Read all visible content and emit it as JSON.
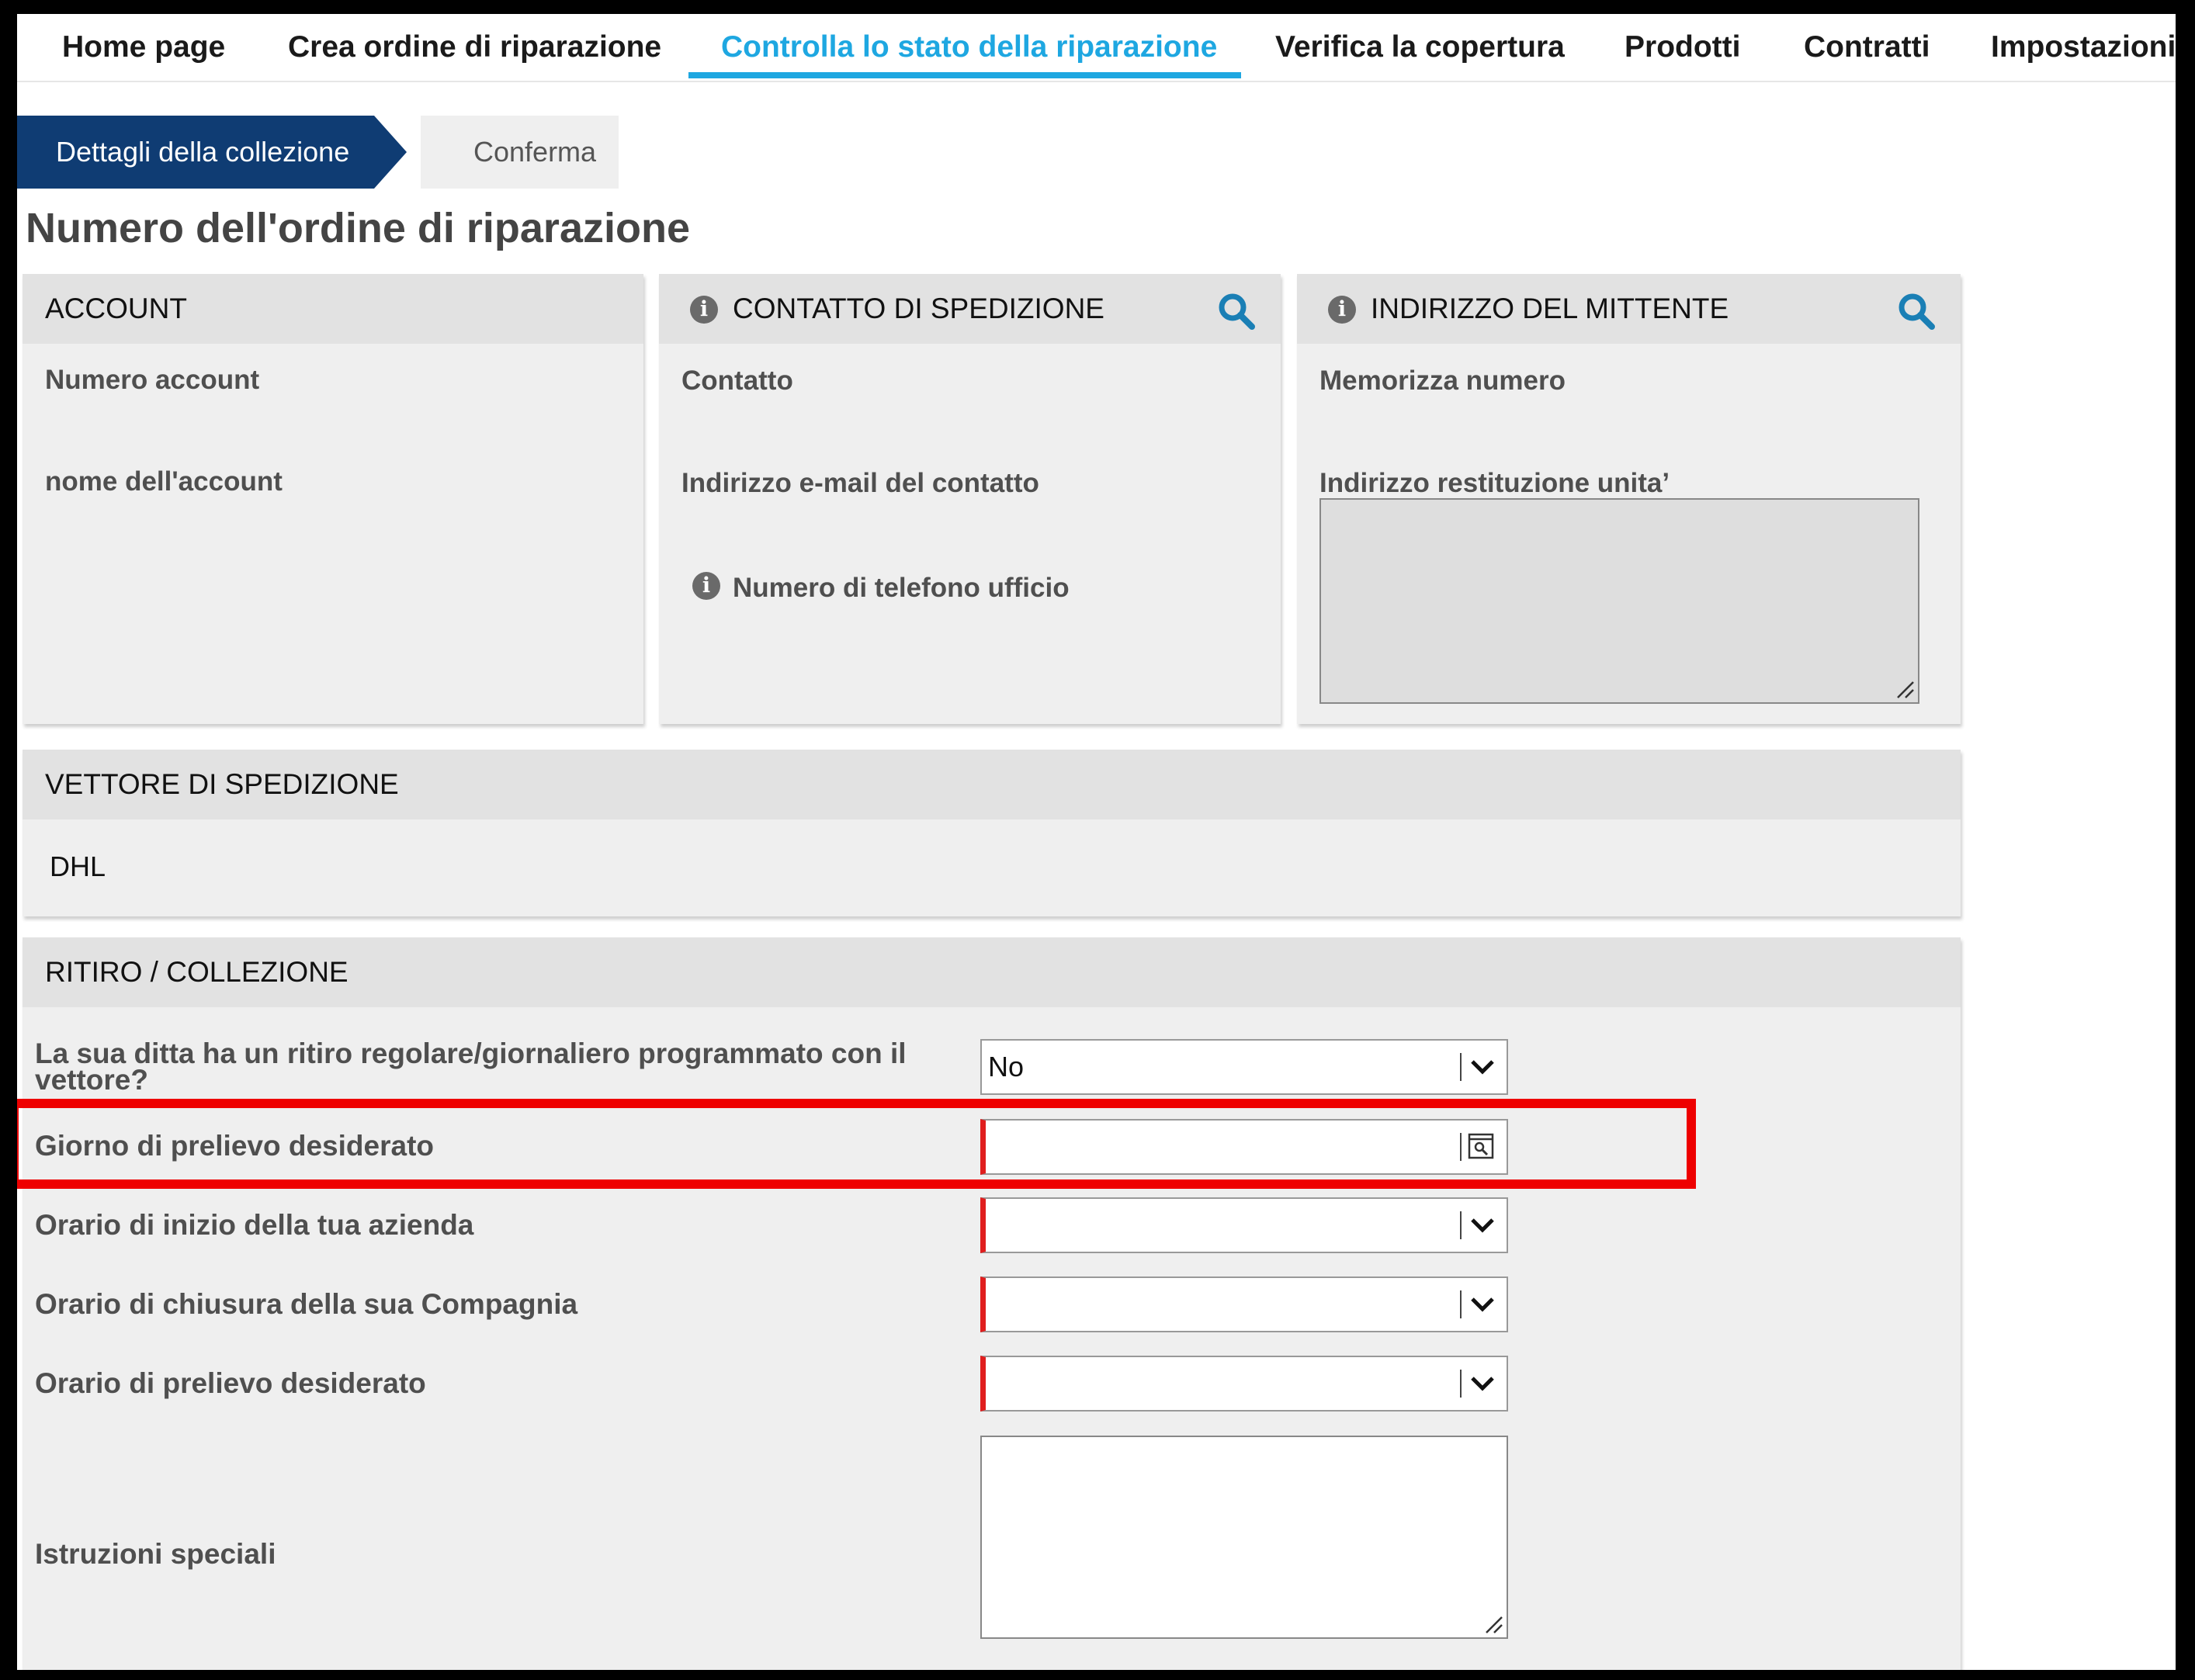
{
  "nav": {
    "items": [
      {
        "label": "Home page"
      },
      {
        "label": "Crea ordine di riparazione"
      },
      {
        "label": "Controlla lo stato della riparazione"
      },
      {
        "label": "Verifica la copertura"
      },
      {
        "label": "Prodotti"
      },
      {
        "label": "Contratti"
      },
      {
        "label": "Impostazioni"
      }
    ],
    "active_index": 2,
    "accent_color": "#1ea7e1"
  },
  "wizard": {
    "steps": [
      {
        "label": "Dettagli della collezione",
        "state": "active"
      },
      {
        "label": "Conferma",
        "state": "inactive"
      }
    ],
    "active_color": "#0f3c73"
  },
  "page": {
    "title": "Numero dell'ordine di riparazione"
  },
  "account_panel": {
    "title": "ACCOUNT",
    "fields": {
      "account_number": "Numero account",
      "account_name": "nome dell'account"
    }
  },
  "shipping_contact_panel": {
    "title": "CONTATTO DI SPEDIZIONE",
    "fields": {
      "contact": "Contatto",
      "email": "Indirizzo e-mail del contatto",
      "office_phone": "Numero di telefono ufficio"
    },
    "icons": [
      "info-icon",
      "search-icon"
    ]
  },
  "sender_address_panel": {
    "title": "INDIRIZZO DEL MITTENTE",
    "fields": {
      "store_number": "Memorizza numero",
      "return_address": "Indirizzo restituzione unita’"
    },
    "icons": [
      "info-icon",
      "search-icon"
    ]
  },
  "carrier_panel": {
    "title": "VETTORE DI SPEDIZIONE",
    "value": "DHL"
  },
  "pickup_panel": {
    "title": "RITIRO / COLLEZIONE",
    "rows": {
      "regular_pickup": {
        "label": "La sua ditta ha un ritiro regolare/giornaliero programmato con il vettore?",
        "value": "No"
      },
      "pickup_day": {
        "label": "Giorno di prelievo desiderato",
        "value": ""
      },
      "start_time": {
        "label": "Orario di inizio della tua azienda",
        "value": ""
      },
      "close_time": {
        "label": "Orario di chiusura della sua Compagnia",
        "value": ""
      },
      "pickup_time": {
        "label": "Orario di prelievo desiderato",
        "value": ""
      },
      "special_instructions": {
        "label": "Istruzioni speciali",
        "value": ""
      }
    }
  },
  "colors": {
    "required_marker": "#e01e1e",
    "highlight": "#ee0000",
    "icon_blue": "#1a7fb5"
  }
}
